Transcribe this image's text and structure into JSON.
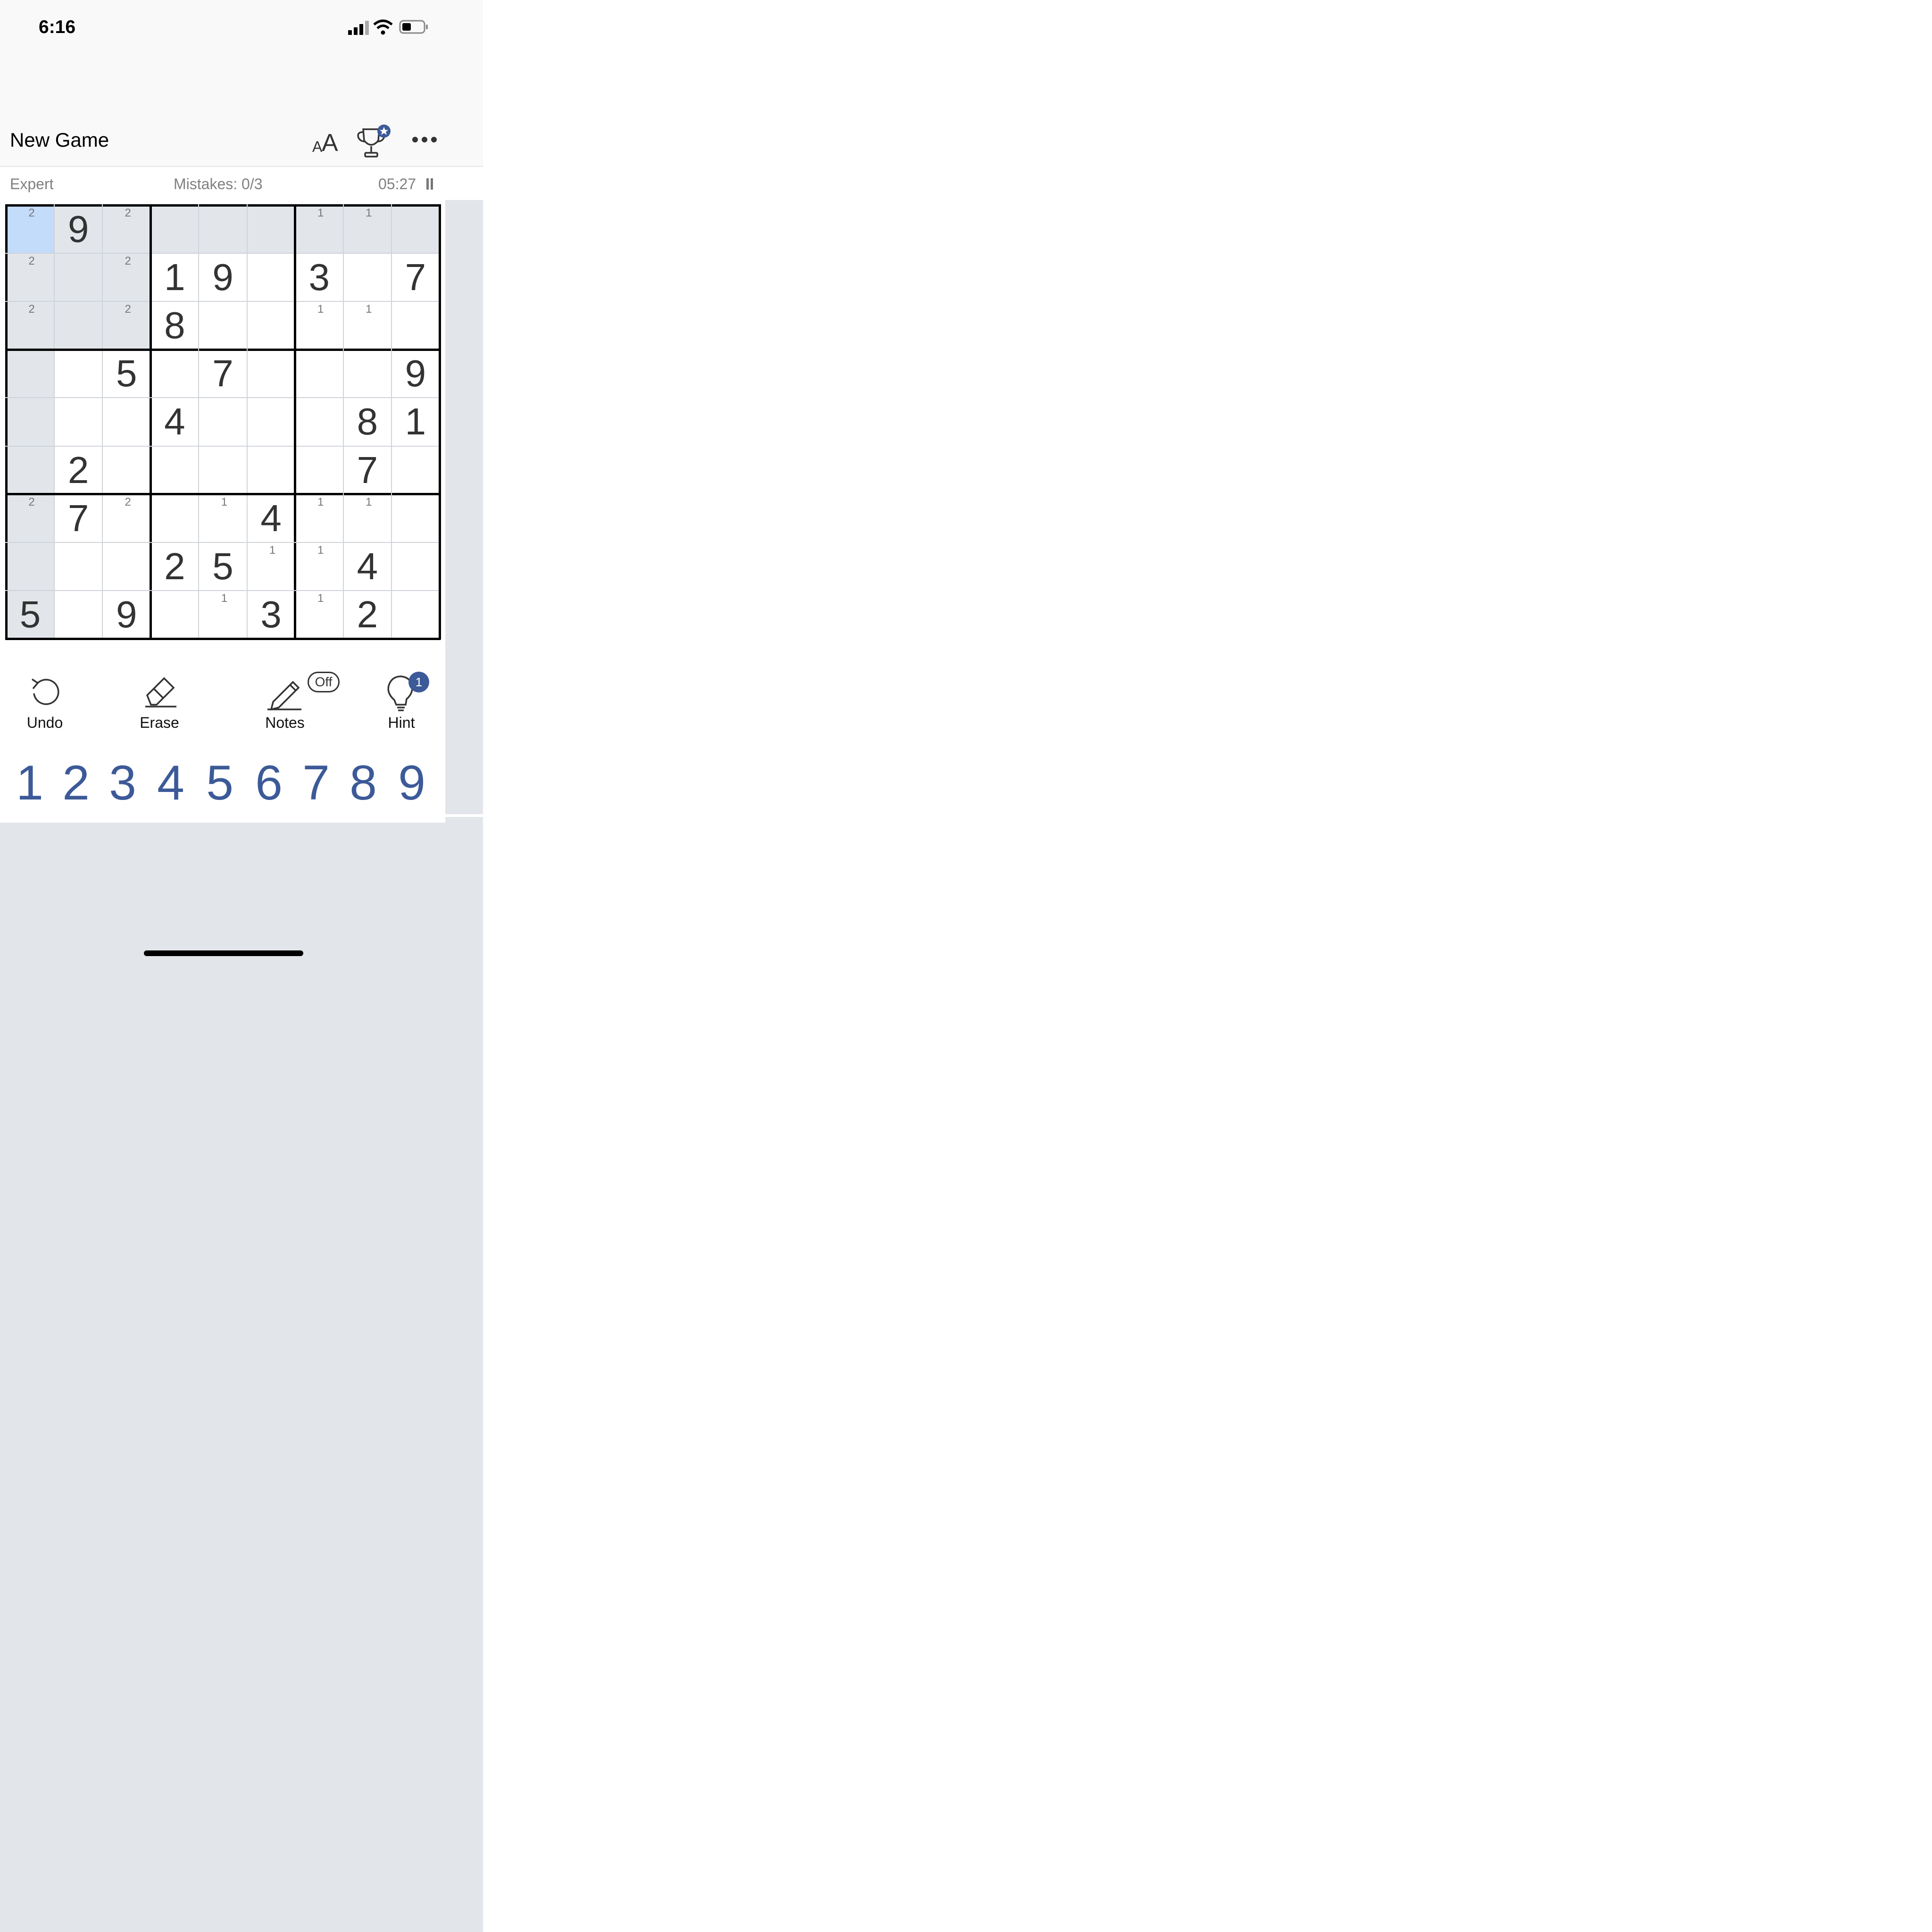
{
  "status_bar": {
    "time": "6:16"
  },
  "nav": {
    "title": "New Game",
    "font_icon": "font-size-icon",
    "trophy_icon": "trophy-icon",
    "more_icon": "more-icon"
  },
  "info": {
    "difficulty": "Expert",
    "mistakes": "Mistakes: 0/3",
    "timer": "05:27"
  },
  "grid": {
    "rows": [
      [
        "",
        "9",
        "",
        "",
        "",
        "",
        "",
        "",
        ""
      ],
      [
        "",
        "",
        "",
        "1",
        "9",
        "",
        "3",
        "",
        "7"
      ],
      [
        "",
        "",
        "",
        "8",
        "",
        "",
        "",
        "",
        ""
      ],
      [
        "",
        "",
        "5",
        "",
        "7",
        "",
        "",
        "",
        "9"
      ],
      [
        "",
        "",
        "",
        "4",
        "",
        "",
        "",
        "8",
        "1"
      ],
      [
        "",
        "2",
        "",
        "",
        "",
        "",
        "",
        "7",
        ""
      ],
      [
        "",
        "7",
        "",
        "",
        "",
        "4",
        "",
        "",
        ""
      ],
      [
        "",
        "",
        "",
        "2",
        "5",
        "",
        "",
        "4",
        ""
      ],
      [
        "5",
        "",
        "9",
        "",
        "",
        "3",
        "",
        "2",
        ""
      ]
    ],
    "notes": [
      [
        "2",
        "",
        "2",
        "",
        "",
        "",
        "1",
        "1",
        ""
      ],
      [
        "2",
        "",
        "2",
        "",
        "",
        "",
        "",
        "",
        ""
      ],
      [
        "2",
        "",
        "2",
        "",
        "",
        "",
        "1",
        "1",
        ""
      ],
      [
        "",
        "",
        "",
        "",
        "",
        "",
        "",
        "",
        ""
      ],
      [
        "",
        "",
        "",
        "",
        "",
        "",
        "",
        "",
        ""
      ],
      [
        "",
        "",
        "",
        "",
        "",
        "",
        "",
        "",
        ""
      ],
      [
        "2",
        "",
        "2",
        "",
        "1",
        "",
        "1",
        "1",
        ""
      ],
      [
        "",
        "",
        "",
        "",
        "",
        "1",
        "1",
        "",
        ""
      ],
      [
        "",
        "",
        "",
        "",
        "1",
        "",
        "1",
        "",
        ""
      ]
    ],
    "selected": [
      0,
      0
    ],
    "colors": {
      "selected": "#c3dcfa",
      "related": "#e2e6eb",
      "normal": "#ffffff"
    }
  },
  "tools": [
    {
      "name": "undo",
      "label": "Undo",
      "icon": "undo-icon"
    },
    {
      "name": "erase",
      "label": "Erase",
      "icon": "eraser-icon"
    },
    {
      "name": "notes",
      "label": "Notes",
      "icon": "pencil-icon",
      "state": "Off"
    },
    {
      "name": "hint",
      "label": "Hint",
      "icon": "bulb-icon",
      "badge": "1"
    }
  ],
  "number_pad": [
    "1",
    "2",
    "3",
    "4",
    "5",
    "6",
    "7",
    "8",
    "9"
  ],
  "accent": "#3c5a98"
}
